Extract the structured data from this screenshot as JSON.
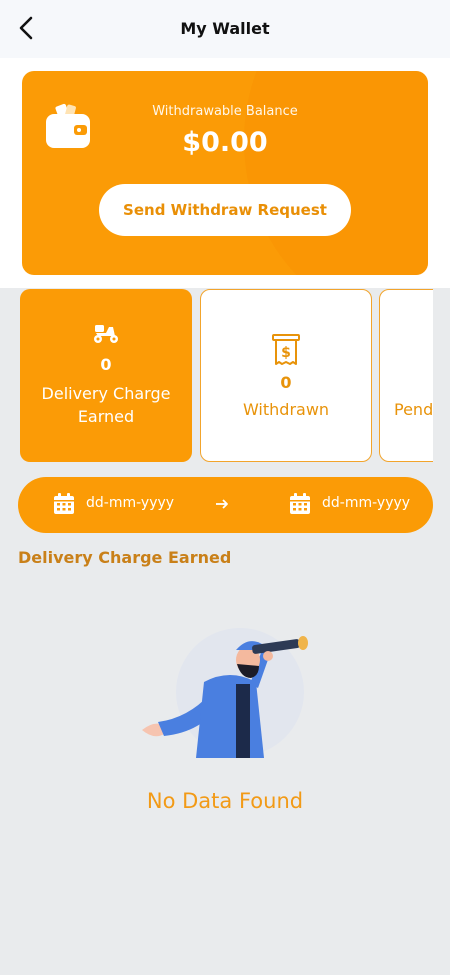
{
  "header": {
    "title": "My Wallet",
    "back_icon": "chevron-left-icon"
  },
  "balance": {
    "label": "Withdrawable Balance",
    "amount": "$0.00",
    "button_label": "Send Withdraw Request",
    "icon": "wallet-icon"
  },
  "stats": [
    {
      "icon": "scooter-icon",
      "value": "0",
      "label": "Delivery Charge Earned",
      "active": true
    },
    {
      "icon": "receipt-dollar-icon",
      "value": "0",
      "label": "Withdrawn",
      "active": false
    },
    {
      "icon": "",
      "value": "",
      "label": "Pend",
      "active": false
    }
  ],
  "date_range": {
    "from_placeholder": "dd-mm-yyyy",
    "to_placeholder": "dd-mm-yyyy"
  },
  "section": {
    "title": "Delivery Charge Earned"
  },
  "empty_state": {
    "text": "No Data Found"
  },
  "colors": {
    "primary": "#fb9b06",
    "accent_text": "#e8930a",
    "background": "#e9ebed"
  }
}
